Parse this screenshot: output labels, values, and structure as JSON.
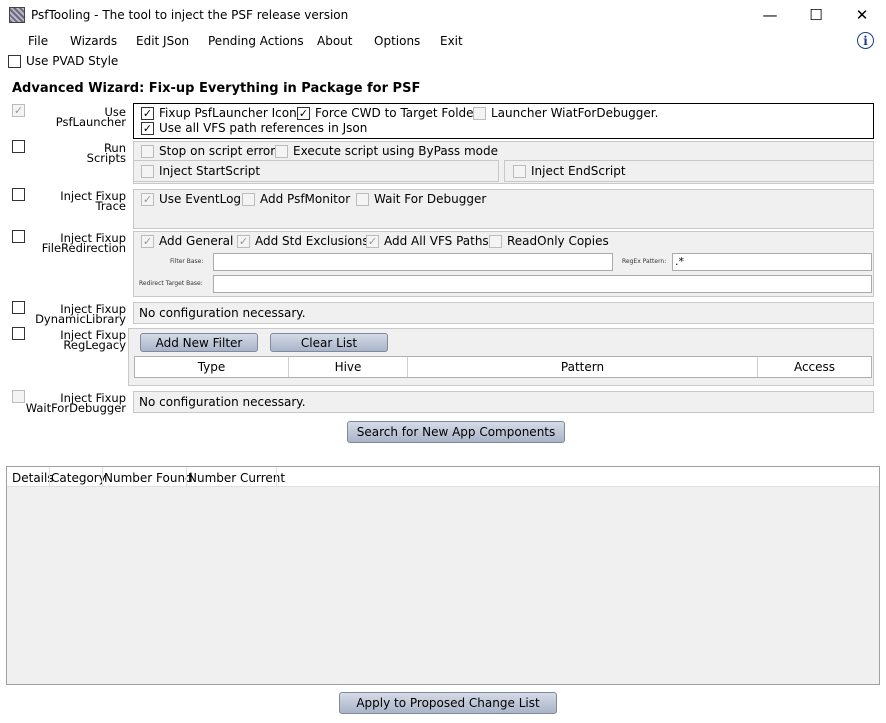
{
  "window": {
    "title": "PsfTooling - The tool to inject the PSF release version",
    "minimize": "—",
    "maximize": "☐",
    "close": "✕"
  },
  "menu": [
    "File",
    "Wizards",
    "Edit JSon",
    "Pending Actions",
    "About",
    "Options",
    "Exit"
  ],
  "info_icon": "i",
  "pvad_label": "Use PVAD Style",
  "wizard_title": "Advanced Wizard: Fix-up Everything in Package for PSF",
  "launcher": {
    "label_line1": "Use",
    "label_line2": "PsfLauncher",
    "opt_icons": "Fixup PsfLauncher Icons",
    "opt_cwd": "Force CWD to Target Folder",
    "opt_debugger": "Launcher WiatForDebugger.",
    "opt_vfs": "Use all VFS path references in Json"
  },
  "scripts": {
    "label_line1": "Run",
    "label_line2": "Scripts",
    "opt_stop": "Stop on script error",
    "opt_bypass": "Execute script using ByPass mode",
    "opt_start": "Inject StartScript",
    "opt_end": "Inject EndScript"
  },
  "trace": {
    "label_line1": "Inject Fixup",
    "label_line2": "Trace",
    "opt_eventlog": "Use EventLog",
    "opt_monitor": "Add PsfMonitor",
    "opt_wait": "Wait For Debugger"
  },
  "fileredir": {
    "label_line1": "Inject Fixup",
    "label_line2": "FileRedirection",
    "opt_general": "Add General",
    "opt_std": "Add Std Exclusions",
    "opt_vfs": "Add All VFS Paths",
    "opt_readonly": "ReadOnly Copies",
    "filter_base_label": "Filter Base:",
    "filter_base_value": "",
    "regex_label": "RegEx Pattern:",
    "regex_value": ".*",
    "redirect_label": "Redirect Target Base:",
    "redirect_value": ""
  },
  "dynlib": {
    "label_line1": "Inject Fixup",
    "label_line2": "DynamicLibrary",
    "message": "No configuration necessary."
  },
  "reglegacy": {
    "label_line1": "Inject Fixup",
    "label_line2": "RegLegacy",
    "add_filter": "Add New Filter",
    "clear_list": "Clear List",
    "columns": [
      "Type",
      "Hive",
      "Pattern",
      "Access"
    ]
  },
  "waitdbg": {
    "label_line1": "Inject Fixup",
    "label_line2": "WaitForDebugger",
    "message": "No configuration necessary."
  },
  "search_button": "Search for New App Components",
  "results_columns": [
    "Details",
    "Category",
    "Number Found",
    "Number Current"
  ],
  "apply_button": "Apply to Proposed Change List"
}
